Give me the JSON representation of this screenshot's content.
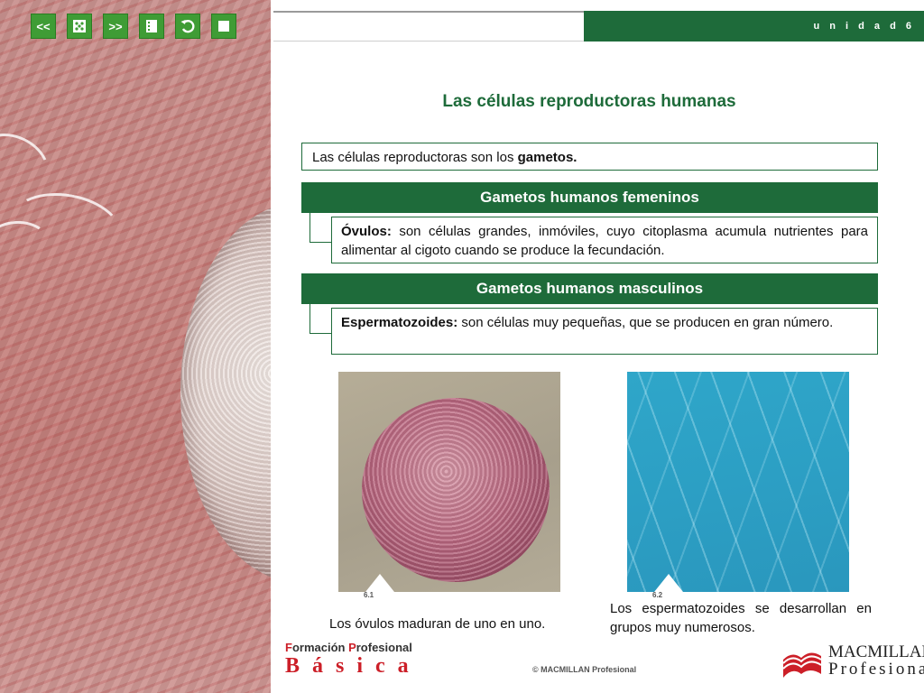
{
  "nav": {
    "prev_label": "<<",
    "next_label": ">>",
    "icons": [
      "dice-icon",
      "index-icon",
      "undo-icon",
      "stop-icon"
    ]
  },
  "header": {
    "unit_label": "u n i d a d  6"
  },
  "main": {
    "title": "Las células reproductoras humanas",
    "intro_text": "Las células reproductoras son los ",
    "intro_bold": "gametos.",
    "female": {
      "heading": "Gametos humanos femeninos",
      "term": "Óvulos:",
      "definition": " son células grandes, inmóviles, cuyo citoplasma acumula nutrientes para alimentar al cigoto cuando se produce la fecundación."
    },
    "male": {
      "heading": "Gametos humanos masculinos",
      "term": "Espermatozoides:",
      "definition": " son células muy pequeñas, que se producen en gran número."
    },
    "figures": [
      {
        "label": "6.1",
        "caption": "Los óvulos maduran de uno en uno."
      },
      {
        "label": "6.2",
        "caption": "Los espermatozoides se desarrollan en grupos muy numerosos."
      }
    ]
  },
  "footer": {
    "fp_initial_1": "F",
    "fp_rest_1": "ormación ",
    "fp_initial_2": "P",
    "fp_rest_2": "rofesional",
    "fp_basica": "Básica",
    "copyright": "© MACMILLAN Profesional",
    "publisher_line1": "MACMILLAN",
    "publisher_line2": "Profesional"
  },
  "colors": {
    "accent": "#1e6b3a",
    "nav_green": "#3f9c35",
    "brand_red": "#cc1f28"
  }
}
